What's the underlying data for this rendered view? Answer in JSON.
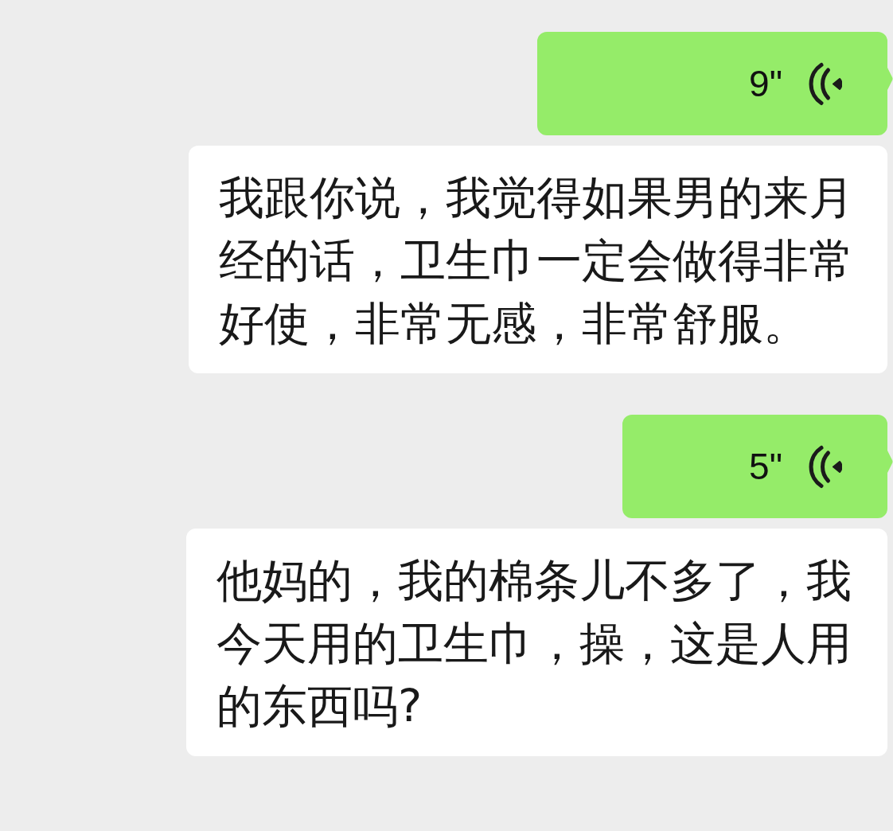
{
  "messages": [
    {
      "kind": "voice",
      "outgoing": true,
      "duration": "9\""
    },
    {
      "kind": "text",
      "outgoing": false,
      "text": "我跟你说，我觉得如果男的来月经的话，卫生巾一定会做得非常好使，非常无感，非常舒服。"
    },
    {
      "kind": "voice",
      "outgoing": true,
      "duration": "5\""
    },
    {
      "kind": "text",
      "outgoing": false,
      "text": "他妈的，我的棉条儿不多了，我今天用的卫生巾，操，这是人用的东西吗?"
    }
  ]
}
